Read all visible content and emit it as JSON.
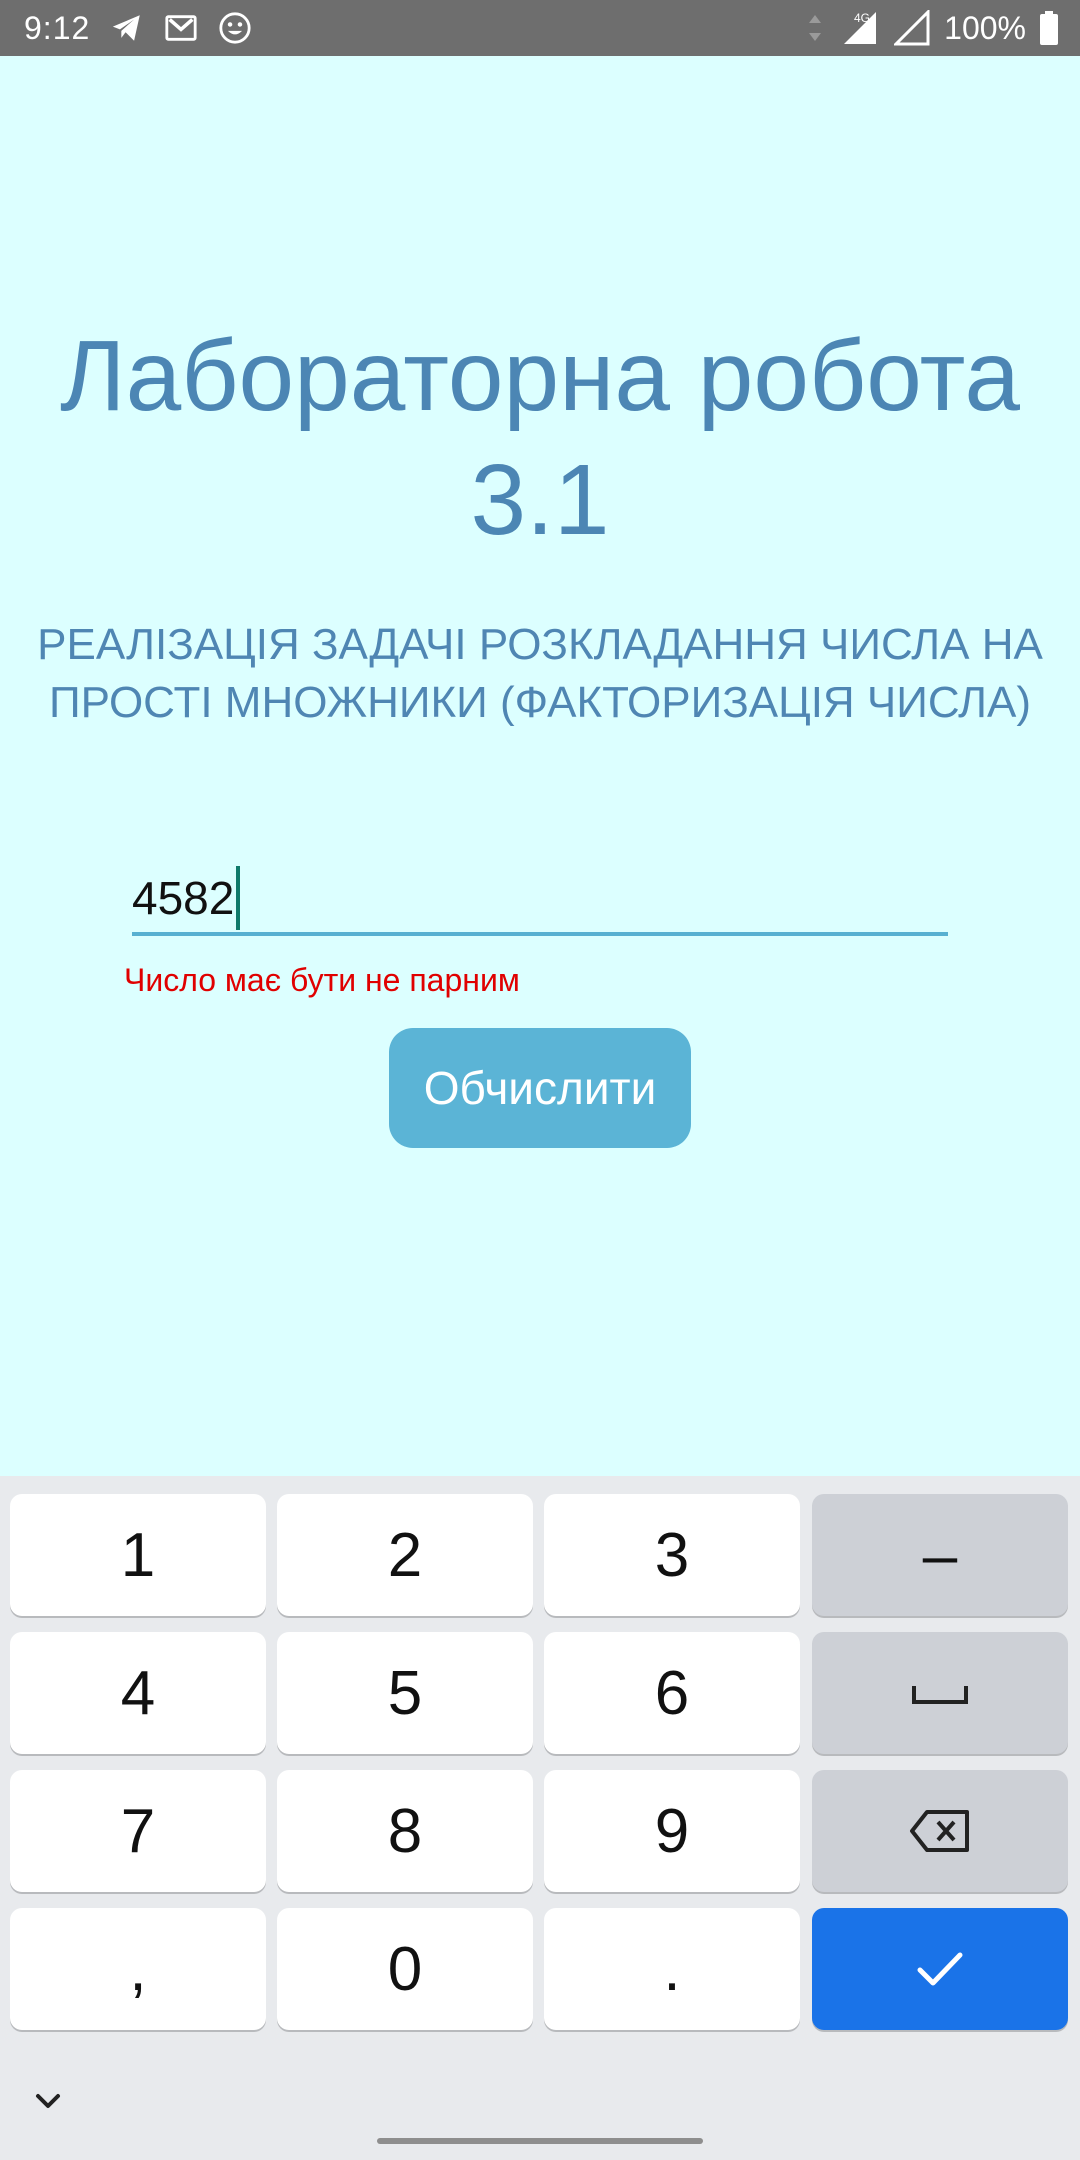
{
  "status_bar": {
    "time": "9:12",
    "network_label": "4G",
    "battery": "100%",
    "icons": [
      "telegram-icon",
      "gmail-icon",
      "emoji-icon",
      "signal-4g-icon",
      "signal-icon",
      "battery-icon"
    ]
  },
  "page": {
    "title": "Лабораторна робота 3.1",
    "subtitle": "РЕАЛІЗАЦІЯ ЗАДАЧІ РОЗКЛАДАННЯ ЧИСЛА НА ПРОСТІ МНОЖНИКИ (ФАКТОРИЗАЦІЯ ЧИСЛА)",
    "input_value": "4582",
    "error": "Число має бути не парним",
    "button_label": "Обчислити"
  },
  "keyboard": {
    "keys": {
      "k1": "1",
      "k2": "2",
      "k3": "3",
      "minus": "–",
      "k4": "4",
      "k5": "5",
      "k6": "6",
      "k7": "7",
      "k8": "8",
      "k9": "9",
      "comma": ",",
      "k0": "0",
      "period": "."
    },
    "icons": [
      "space-icon",
      "backspace-icon",
      "checkmark-icon",
      "chevron-down-icon"
    ]
  },
  "colors": {
    "background": "#dcffff",
    "title": "#4c86b4",
    "error": "#e00000",
    "button": "#5bb4d6",
    "enter_key": "#1a73e8"
  }
}
